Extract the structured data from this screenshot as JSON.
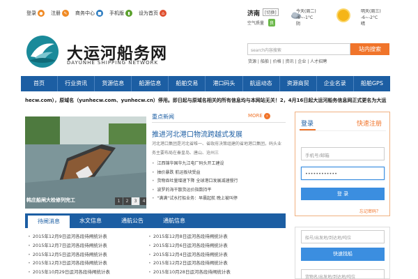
{
  "topbar": {
    "links": [
      {
        "label": "登录",
        "icon": "user-icon"
      },
      {
        "label": "注册",
        "icon": "register-icon"
      },
      {
        "label": "商务中心",
        "icon": "business-icon"
      },
      {
        "label": "手机版",
        "icon": "mobile-icon"
      },
      {
        "label": "设为首页",
        "icon": "home-icon"
      }
    ]
  },
  "weather": {
    "city": "济南",
    "switch": "[切换]",
    "aqi_label": "空气质量",
    "aqi_value": "良",
    "today_label": "今天(周二)",
    "today_temp": "-6~-1°C",
    "today_desc": "阴",
    "tomorrow_label": "明天(周三)",
    "tomorrow_temp": "-6~-2°C",
    "tomorrow_desc": "晴"
  },
  "header": {
    "logo_cn": "大运河船务网",
    "logo_en": "DAYUNHE SHIPPING NETWORK",
    "search_placeholder": "search内容搜索",
    "search_button": "站内搜索",
    "search_hints": "货源 | 船舶 | 价格 | 资讯 | 企业 | 人才招聘"
  },
  "nav": [
    "首页",
    "行业资讯",
    "货源信息",
    "船源信息",
    "船舶交易",
    "港口码头",
    "航运动态",
    "资源商贸",
    "企业名录",
    "船舶GPS"
  ],
  "ticker": "hecw.com），原域名（yunhecw.com、yunhecw.cn）停用。即日起与原域名相关的所有信息均与本网站无关！2，4月16日起大运河船务信息网正式更名为大运",
  "slide": {
    "caption": "韩庄船闸大检修列完工",
    "dots": [
      "1",
      "2",
      "3",
      "4",
      "5"
    ],
    "active_dot": 3
  },
  "key_news": {
    "title": "重点新闻",
    "more": "MORE",
    "headline": "推进河北港口物流跨越式发展",
    "summary": "河北港口集团是河北省唯一、省政府决策组建的省地港口集团，码头业务主要布局在秦皇岛、唐山、沧州三",
    "items": [
      "江西锦华国华九江电厂码头开工建设",
      "抽价暴跌 航运板块受益",
      "货物吞吐量增速下降 全球港口发展减速慢行",
      "波罗的海干散货运价指数持平",
      "\"满满\"试水打船业务：早晨起航 晚上被叫停"
    ]
  },
  "tabs": [
    "待闸消息",
    "水文信息",
    "通航公告",
    "通航信息"
  ],
  "lists": {
    "left": [
      "2015年12月9日运河各段待闸统计表",
      "2015年12月7日运河各段待闸统计表",
      "2015年12月5日运河各段待闸统计表",
      "2015年12月3日运河各段待闸统计表",
      "2015年10月29日运河各段待闸统计表"
    ],
    "right": [
      "2015年12月8日运河各段待闸统计表",
      "2015年12月6日运河各段待闸统计表",
      "2015年12月4日运河各段待闸统计表",
      "2015年12月2日运河各段待闸统计表",
      "2015年10月28日运河各段待闸统计表"
    ]
  },
  "login": {
    "tab": "登录",
    "register": "快速注册",
    "user_placeholder": "手机号/邮箱",
    "password_value": "••••••••••••",
    "button": "登 录",
    "forgot": "忘记密码？"
  },
  "ship_search": {
    "placeholder1": "船号/出发地/到达地/吨位",
    "button": "快速找船",
    "placeholder2": "货物名/出发地/到达地/吨位"
  },
  "colors": {
    "primary": "#1c5ea3",
    "accent": "#f0742a",
    "button_blue": "#3b8ee0"
  }
}
